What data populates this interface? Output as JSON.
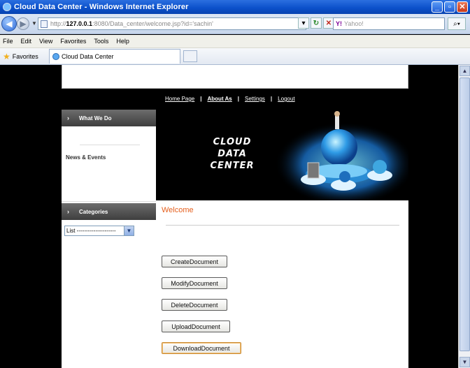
{
  "window": {
    "title": "Cloud Data Center - Windows Internet Explorer"
  },
  "address": {
    "url_prefix": "http://",
    "url_host": "127.0.0.1",
    "url_rest": ":8080/Data_center/welcome.jsp?id='sachin'",
    "search_placeholder": "Yahoo!",
    "search_brand": "Y!"
  },
  "menu": {
    "items": [
      "File",
      "Edit",
      "View",
      "Favorites",
      "Tools",
      "Help"
    ]
  },
  "favorites_bar": {
    "favorites_label": "Favorites",
    "tab_title": "Cloud Data Center"
  },
  "site": {
    "nav": {
      "home": "Home Page",
      "about": "About As",
      "settings": "Settings",
      "logout": "Logout"
    },
    "sidebar": {
      "what_we_do": "What We Do",
      "news_events": "News & Events",
      "categories": "Categories",
      "list_value": "List ---------------------"
    },
    "banner": {
      "line1": "CLOUD DATA",
      "line2": "CENTER"
    },
    "welcome": "Welcome",
    "buttons": {
      "create": "CreateDocument",
      "modify": "ModifyDocument",
      "delete": "DeleteDocument",
      "upload": "UploadDocument",
      "download": "DownloadDocument"
    }
  },
  "colors": {
    "accent_welcome": "#e5601e",
    "titlebar": "#0a4fc9"
  }
}
